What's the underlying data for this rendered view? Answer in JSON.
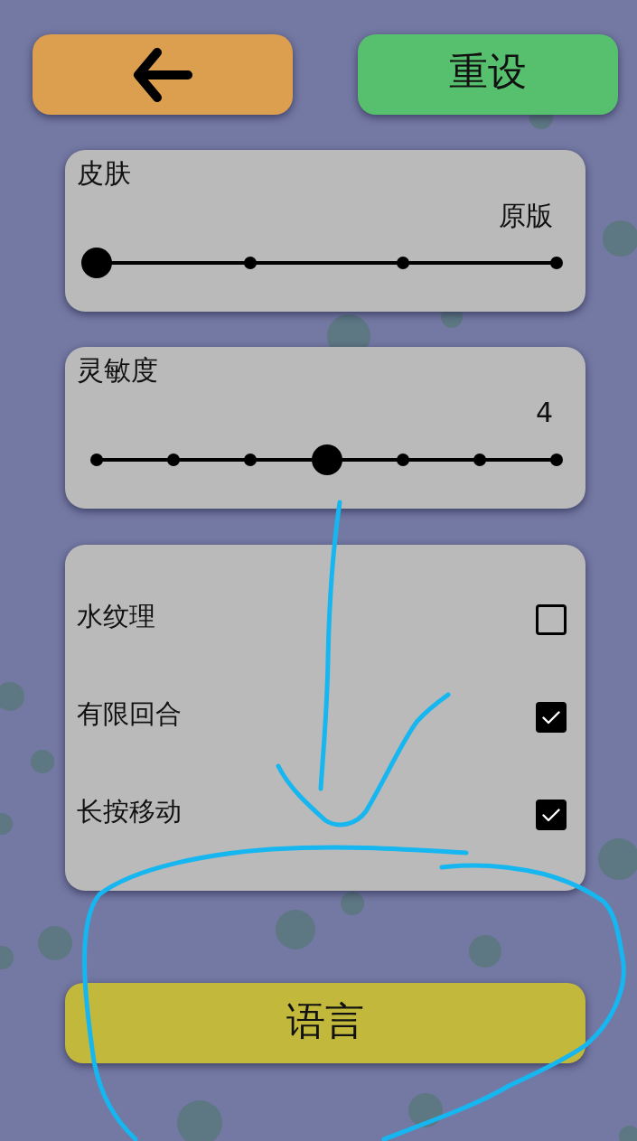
{
  "header_buttons": [
    {
      "kind": "back"
    },
    {
      "kind": "reset",
      "label": "重设"
    }
  ],
  "settings": [
    {
      "kind": "slider",
      "title": "皮肤",
      "value": "原版",
      "stops": [
        {
          "selected": true
        },
        {
          "selected": false
        },
        {
          "selected": false
        },
        {
          "selected": false
        }
      ]
    },
    {
      "kind": "slider",
      "title": "灵敏度",
      "value": "4",
      "stops": [
        {
          "selected": false
        },
        {
          "selected": false
        },
        {
          "selected": false
        },
        {
          "selected": true
        },
        {
          "selected": false
        },
        {
          "selected": false
        },
        {
          "selected": false
        }
      ]
    }
  ],
  "toggles": [
    {
      "label": "水纹理",
      "checked": false
    },
    {
      "label": "有限回合",
      "checked": true
    },
    {
      "label": "长按移动",
      "checked": true
    }
  ],
  "language_button": {
    "label": "语言"
  }
}
